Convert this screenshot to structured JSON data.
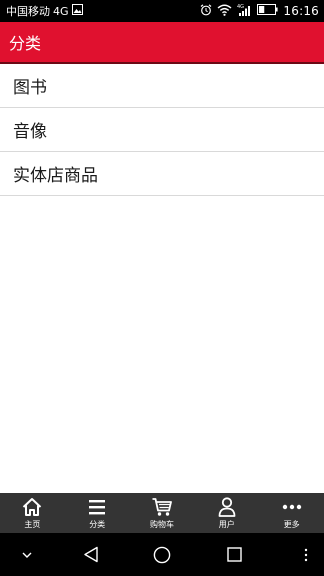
{
  "status_bar": {
    "carrier": "中国移动",
    "network": "4G",
    "time": "16:16",
    "battery_level": 0.35,
    "icons": [
      "photo-icon",
      "alarm-icon",
      "wifi-icon",
      "signal-icon",
      "battery-icon"
    ]
  },
  "header": {
    "title": "分类"
  },
  "categories": [
    {
      "label": "图书"
    },
    {
      "label": "音像"
    },
    {
      "label": "实体店商品"
    }
  ],
  "tab_bar": {
    "tabs": [
      {
        "label": "主页",
        "icon": "home-icon"
      },
      {
        "label": "分类",
        "icon": "menu-icon"
      },
      {
        "label": "购物车",
        "icon": "cart-icon"
      },
      {
        "label": "用户",
        "icon": "user-icon"
      },
      {
        "label": "更多",
        "icon": "more-icon"
      }
    ]
  },
  "nav_bar": {
    "buttons": [
      "chevron-down-icon",
      "back-icon",
      "home-circle-icon",
      "recents-icon",
      "overflow-icon"
    ]
  },
  "colors": {
    "header": "#e0112f",
    "tab_bar": "#343434"
  }
}
